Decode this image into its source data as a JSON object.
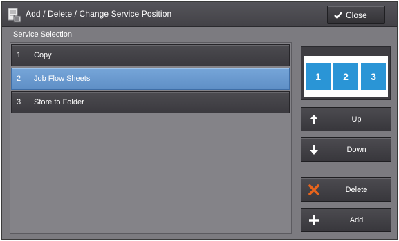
{
  "window": {
    "title": "Add / Delete / Change Service Position",
    "close_label": "Close"
  },
  "section": {
    "label": "Service Selection"
  },
  "services": [
    {
      "num": "1",
      "label": "Copy",
      "selected": false
    },
    {
      "num": "2",
      "label": "Job Flow Sheets",
      "selected": true
    },
    {
      "num": "3",
      "label": "Store to Folder",
      "selected": false
    }
  ],
  "preview": {
    "tiles": [
      "1",
      "2",
      "3"
    ],
    "tile_color": "#2a95d6"
  },
  "buttons": {
    "up_label": "Up",
    "down_label": "Down",
    "delete_label": "Delete",
    "add_label": "Add"
  },
  "colors": {
    "selected_row": "#6a99d0",
    "delete_icon": "#e8641c",
    "background": "#7c7b80"
  },
  "icons": {
    "title": "document-settings-icon",
    "close": "check-icon",
    "up": "arrow-up-icon",
    "down": "arrow-down-icon",
    "delete": "x-icon",
    "add": "plus-icon"
  }
}
